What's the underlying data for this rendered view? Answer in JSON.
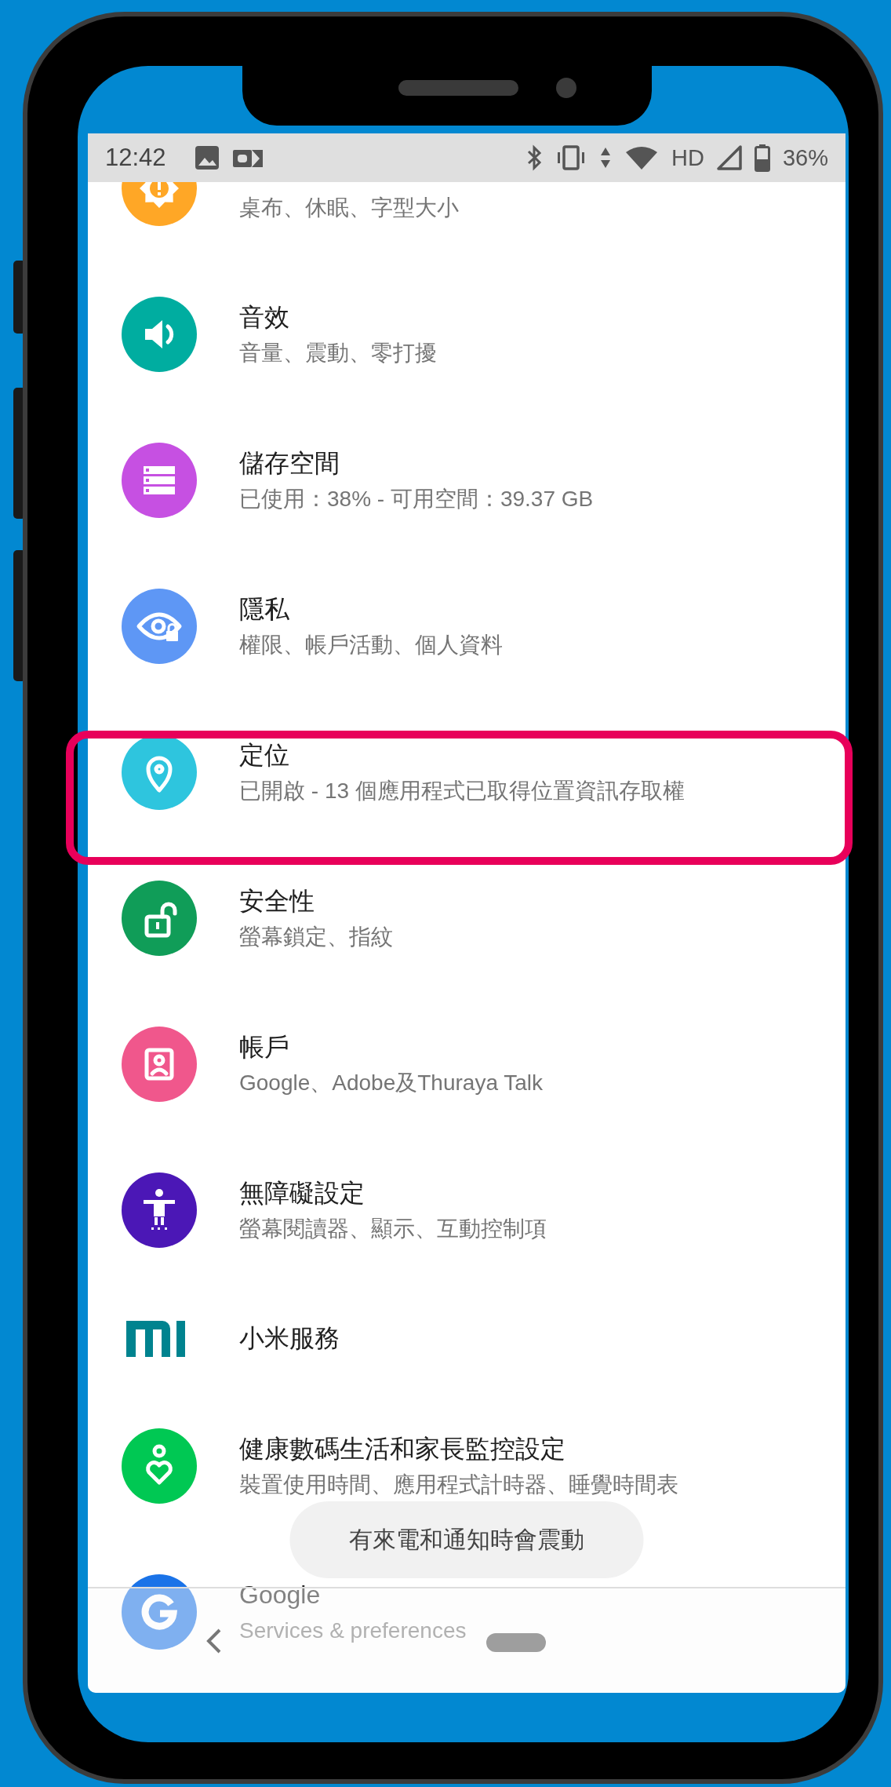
{
  "status_bar": {
    "time": "12:42",
    "network": "HD",
    "battery": "36%"
  },
  "items": [
    {
      "kind": "display",
      "color": "#ffa726",
      "subtitle": "桌布、休眠、字型大小",
      "highlighted": false
    },
    {
      "kind": "sound",
      "color": "#00ada0",
      "title": "音效",
      "subtitle": "音量、震動、零打擾",
      "highlighted": false
    },
    {
      "kind": "storage",
      "color": "#c650e2",
      "title": "儲存空間",
      "subtitle": "已使用：38% - 可用空間：39.37 GB",
      "highlighted": false
    },
    {
      "kind": "privacy",
      "color": "#5e97f5",
      "title": "隱私",
      "subtitle": "權限、帳戶活動、個人資料",
      "highlighted": false
    },
    {
      "kind": "location",
      "color": "#2ec5de",
      "title": "定位",
      "subtitle": "已開啟 - 13 個應用程式已取得位置資訊存取權",
      "highlighted": true
    },
    {
      "kind": "security",
      "color": "#109d58",
      "title": "安全性",
      "subtitle": "螢幕鎖定、指紋",
      "highlighted": false
    },
    {
      "kind": "account",
      "color": "#f0578c",
      "title": "帳戶",
      "subtitle": "Google、Adobe及Thuraya Talk",
      "highlighted": false
    },
    {
      "kind": "accessibility",
      "color": "#4b17b6",
      "title": "無障礙設定",
      "subtitle": "螢幕閱讀器、顯示、互動控制項",
      "highlighted": false
    },
    {
      "kind": "mi",
      "color": "#00838f",
      "title": "小米服務",
      "highlighted": false
    },
    {
      "kind": "wellbeing",
      "color": "#00c853",
      "title": "健康數碼生活和家長監控設定",
      "subtitle": "裝置使用時間、應用程式計時器、睡覺時間表",
      "highlighted": false
    },
    {
      "kind": "google",
      "color": "#1a73e8",
      "title": "Google",
      "subtitle": "Services & preferences",
      "highlighted": false
    }
  ],
  "toast": {
    "text": "有來電和通知時會震動"
  }
}
